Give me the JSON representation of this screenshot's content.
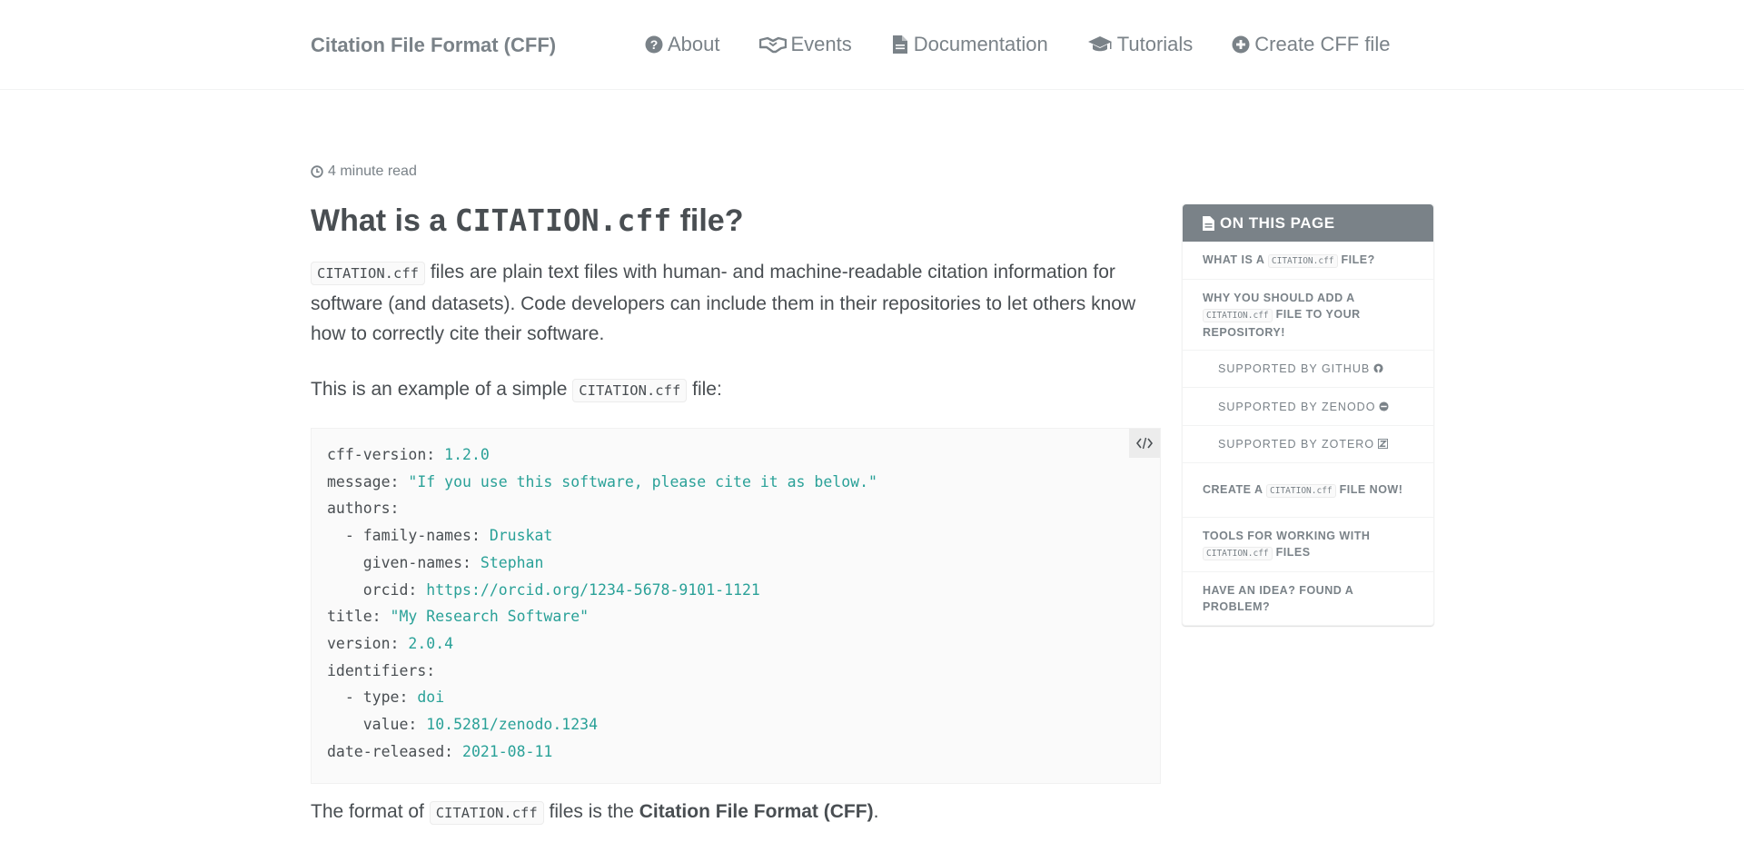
{
  "header": {
    "site_title": "Citation File Format (CFF)",
    "nav": [
      {
        "label": "About",
        "icon": "question-circle-icon"
      },
      {
        "label": "Events",
        "icon": "handshake-icon"
      },
      {
        "label": "Documentation",
        "icon": "file-icon"
      },
      {
        "label": "Tutorials",
        "icon": "graduation-cap-icon"
      },
      {
        "label": "Create CFF file",
        "icon": "plus-circle-icon"
      }
    ]
  },
  "meta": {
    "read_time": "4 minute read"
  },
  "article": {
    "title_pre": "What is a ",
    "title_code": "CITATION.cff",
    "title_post": " file?",
    "intro_code": "CITATION.cff",
    "intro_text": " files are plain text files with human- and machine-readable citation information for software (and datasets). Code developers can include them in their repositories to let others know how to correctly cite their software.",
    "example_pre": "This is an example of a simple ",
    "example_code": "CITATION.cff",
    "example_post": " file:",
    "code_lines": [
      {
        "key": "cff-version: ",
        "val": "1.2.0"
      },
      {
        "key": "message: ",
        "val": "\"If you use this software, please cite it as below.\""
      },
      {
        "key": "authors:",
        "val": ""
      },
      {
        "key": "  - family-names: ",
        "val": "Druskat"
      },
      {
        "key": "    given-names: ",
        "val": "Stephan"
      },
      {
        "key": "    orcid: ",
        "val": "https://orcid.org/1234-5678-9101-1121"
      },
      {
        "key": "title: ",
        "val": "\"My Research Software\""
      },
      {
        "key": "version: ",
        "val": "2.0.4"
      },
      {
        "key": "identifiers:",
        "val": ""
      },
      {
        "key": "  - type: ",
        "val": "doi"
      },
      {
        "key": "    value: ",
        "val": "10.5281/zenodo.1234"
      },
      {
        "key": "date-released: ",
        "val": "2021-08-11"
      }
    ],
    "format_pre": "The format of ",
    "format_code": "CITATION.cff",
    "format_mid": " files is the ",
    "format_bold": "Citation File Format (CFF)",
    "format_post": "."
  },
  "toc": {
    "title": "ON THIS PAGE",
    "items": {
      "i1_pre": "What is a ",
      "i1_code": "CITATION.cff",
      "i1_post": " file?",
      "i2_pre": "Why you should add a ",
      "i2_code": "CITATION.cff",
      "i2_post": " file to your repository!",
      "i3": "Supported by GitHub",
      "i4": "Supported by Zenodo",
      "i5": "Supported by Zotero",
      "i6_pre": "Create a ",
      "i6_code": "CITATION.cff",
      "i6_post": " file now!",
      "i7_pre": "Tools for working with ",
      "i7_code": "CITATION.cff",
      "i7_post": " files",
      "i8": "Have an idea? Found a problem?"
    }
  },
  "colors": {
    "text": "#494e52",
    "muted": "#7a8288",
    "code_value": "#2aa198"
  }
}
